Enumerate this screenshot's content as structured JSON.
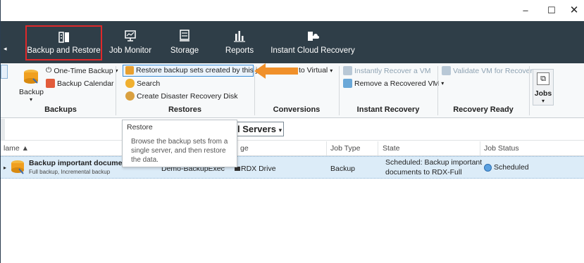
{
  "window": {
    "minimize": "–",
    "maximize": "☐",
    "close": "✕"
  },
  "nav": {
    "tabs": [
      {
        "label": "Backup and Restore",
        "icon": "backup-restore-icon",
        "active": true
      },
      {
        "label": "Job Monitor",
        "icon": "job-monitor-icon"
      },
      {
        "label": "Storage",
        "icon": "storage-icon"
      },
      {
        "label": "Reports",
        "icon": "reports-icon"
      },
      {
        "label": "Instant Cloud Recovery",
        "icon": "cloud-recovery-icon"
      }
    ]
  },
  "ribbon": {
    "backups": {
      "label": "Backups",
      "backup_button": "Backup",
      "one_time_backup": "One-Time Backup",
      "backup_calendar": "Backup Calendar"
    },
    "restores": {
      "label": "Restores",
      "restore_job": "Restore backup sets created by this job",
      "search": "Search",
      "disaster_recovery": "Create Disaster Recovery Disk"
    },
    "conversions": {
      "label": "Conversions",
      "to_virtual": "to Virtual"
    },
    "instant_recovery": {
      "label": "Instant Recovery",
      "instantly_recover": "Instantly Recover a VM",
      "remove_recovered": "Remove a Recovered VM"
    },
    "recovery_ready": {
      "label": "Recovery Ready",
      "validate_vm": "Validate VM for Recovery"
    },
    "jobs": {
      "label": "Jobs"
    }
  },
  "toolbar": {
    "server_filter": "l Servers"
  },
  "tooltip": {
    "title": "Restore",
    "body": "Browse the backup sets from a single server, and then restore the data."
  },
  "table": {
    "headers": [
      "lame ▲",
      "ge",
      "Job Type",
      "State",
      "Job Status"
    ],
    "rows": [
      {
        "name": "Backup important documents",
        "subtitle": "Full backup, Incremental backup",
        "server": "Demo-BackupExec",
        "storage": "RDX Drive",
        "job_type": "Backup",
        "state_line1": "Scheduled: Backup important",
        "state_line2": "documents to RDX-Full",
        "status": "Scheduled"
      }
    ]
  },
  "colors": {
    "navbar": "#2f3e48",
    "active_outline": "#e0282a",
    "arrow": "#f0902a",
    "selected_row": "#dcecf8"
  }
}
